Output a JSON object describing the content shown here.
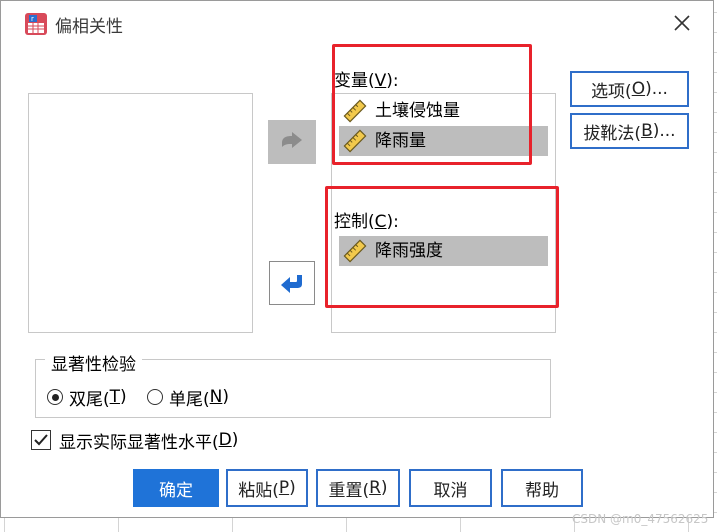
{
  "window": {
    "title": "偏相关性",
    "icon": "spss-partial-correlation-icon",
    "close_icon": "close-icon"
  },
  "variables_section": {
    "label_prefix": "变量(",
    "label_key": "V",
    "label_suffix": "):",
    "items": [
      {
        "label": "土壤侵蚀量",
        "icon": "scale-ruler-icon",
        "selected": false
      },
      {
        "label": "降雨量",
        "icon": "scale-ruler-icon",
        "selected": true
      }
    ]
  },
  "controls_section": {
    "label_prefix": "控制(",
    "label_key": "C",
    "label_suffix": "):",
    "items": [
      {
        "label": "降雨强度",
        "icon": "scale-ruler-icon",
        "selected": true
      }
    ]
  },
  "side_buttons": {
    "options": {
      "prefix": "选项(",
      "key": "O",
      "suffix": ")..."
    },
    "bootstrap": {
      "prefix": "拔靴法(",
      "key": "B",
      "suffix": ")..."
    }
  },
  "significance_test": {
    "title": "显著性检验",
    "options": [
      {
        "prefix": "双尾(",
        "key": "T",
        "suffix": ")",
        "checked": true
      },
      {
        "prefix": "单尾(",
        "key": "N",
        "suffix": ")",
        "checked": false
      }
    ]
  },
  "display_actual_significance": {
    "prefix": "显示实际显著性水平(",
    "key": "D",
    "suffix": ")",
    "checked": true
  },
  "bottom_buttons": {
    "ok": "确定",
    "paste": {
      "prefix": "粘贴(",
      "key": "P",
      "suffix": ")"
    },
    "reset": {
      "prefix": "重置(",
      "key": "R",
      "suffix": ")"
    },
    "cancel": "取消",
    "help": "帮助"
  },
  "watermark": "CSDN @m0_47562625",
  "colors": {
    "accent_blue": "#1f73d8",
    "button_border": "#2f6ec9",
    "selection_gray": "#bdbdbd",
    "annotation_red": "#e8222b"
  }
}
